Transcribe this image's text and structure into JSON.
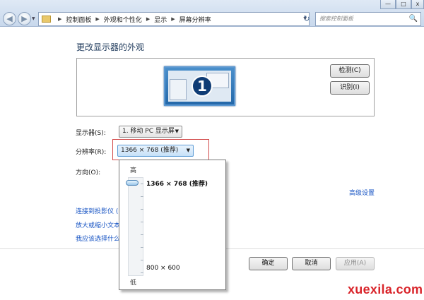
{
  "window": {
    "minimize": "—",
    "maximize": "□",
    "close": "x"
  },
  "nav": {
    "back": "◀",
    "forward": "▶",
    "dropdown": "▼",
    "refresh": "↻"
  },
  "breadcrumbs": [
    "控制面板",
    "外观和个性化",
    "显示",
    "屏幕分辨率"
  ],
  "search": {
    "placeholder": "搜索控制面板",
    "icon": "🔍"
  },
  "page": {
    "title": "更改显示器的外观"
  },
  "preview": {
    "monitor_number": "1",
    "detect_button": "检测(C)",
    "identify_button": "识别(I)"
  },
  "settings": {
    "display_label": "显示器(S):",
    "display_value": "1. 移动 PC 显示屏",
    "resolution_label": "分辨率(R):",
    "resolution_value": "1366 × 768 (推荐)",
    "orientation_label": "方向(O):"
  },
  "links": {
    "advanced": "高级设置",
    "projector": "连接到投影仪 (",
    "text_size": "放大或缩小文本",
    "which_settings": "我应该选择什么"
  },
  "resolution_slider": {
    "high_label": "高",
    "low_label": "低",
    "top_value": "1366 × 768 (推荐)",
    "bottom_value": "800 × 600",
    "selected_position": 1.0
  },
  "footer": {
    "ok": "确定",
    "cancel": "取消",
    "apply": "应用(A)"
  },
  "watermark": "xuexila.com",
  "colors": {
    "accent": "#1e395b",
    "link": "#1a56c4",
    "highlight_box": "#d24a4a",
    "watermark": "#d9242a"
  }
}
